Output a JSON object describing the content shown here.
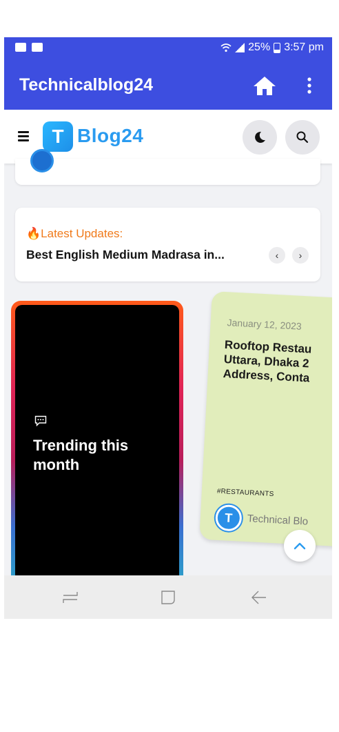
{
  "status_bar": {
    "battery": "25%",
    "time": "3:57 pm"
  },
  "app_bar": {
    "title": "Technicalblog24"
  },
  "site_header": {
    "logo_letter": "T",
    "logo_text": "Blog24"
  },
  "latest_updates": {
    "label": "Latest Updates:",
    "headline": "Best English Medium Madrasa in...",
    "prev": "‹",
    "next": "›"
  },
  "trending": {
    "title": "Trending this month"
  },
  "post_card": {
    "date": "January 12, 2023",
    "title": "Rooftop Restau\nUttara, Dhaka 2\nAddress, Conta",
    "tag": "#RESTAURANTS",
    "author_initial": "T",
    "author": "Technical Blo"
  },
  "colors": {
    "primary": "#3d4ee0",
    "logo_blue": "#2a9bf0",
    "accent_orange": "#f07a1a",
    "post_card_bg": "#e1edbb"
  }
}
